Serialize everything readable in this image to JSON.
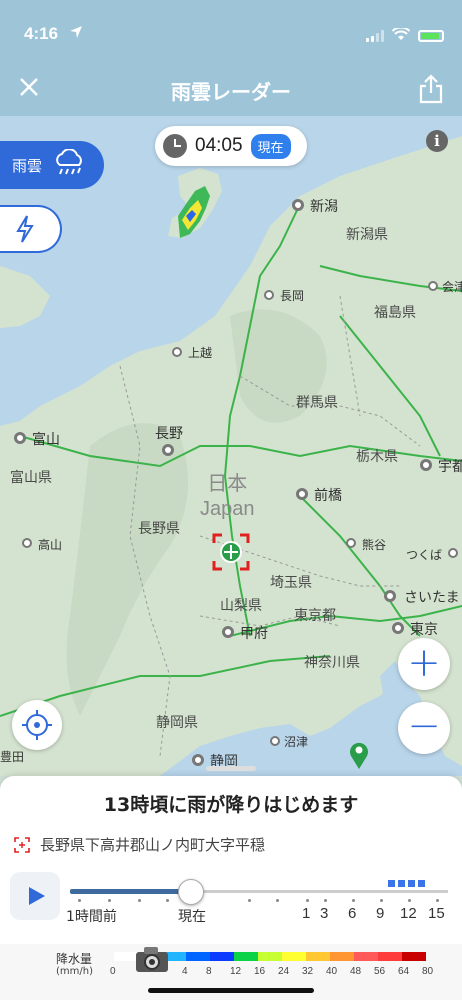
{
  "status_bar": {
    "time": "4:16"
  },
  "header": {
    "title": "雨雲レーダー"
  },
  "time_pill": {
    "time": "04:05",
    "badge": "現在"
  },
  "side_buttons": {
    "rain_label": "雨雲"
  },
  "map": {
    "cities": [
      {
        "name": "新潟"
      },
      {
        "name": "会津"
      },
      {
        "name": "長岡"
      },
      {
        "name": "上越"
      },
      {
        "name": "富山"
      },
      {
        "name": "長野"
      },
      {
        "name": "前橋"
      },
      {
        "name": "宇都"
      },
      {
        "name": "高山"
      },
      {
        "name": "熊谷"
      },
      {
        "name": "つくば"
      },
      {
        "name": "さいたま"
      },
      {
        "name": "甲府"
      },
      {
        "name": "東京"
      },
      {
        "name": "沼津"
      },
      {
        "name": "静岡"
      },
      {
        "name": "豊田"
      }
    ],
    "prefectures": [
      "新潟県",
      "福島県",
      "群馬県",
      "栃木県",
      "富山県",
      "長野県",
      "埼玉県",
      "山梨県",
      "東京都",
      "神奈川県",
      "静岡県"
    ],
    "country": "日本",
    "country_en": "Japan"
  },
  "sheet": {
    "forecast": "13時頃に雨が降りはじめます",
    "location": "長野県下高井郡山ノ内町大字平穏",
    "timeline": {
      "before": "1時間前",
      "now": "現在",
      "hours": [
        "1",
        "3",
        "6",
        "9",
        "12",
        "15"
      ],
      "progress_fraction": 0.32
    }
  },
  "legend": {
    "title": "降水量",
    "unit": "(mm/h)",
    "values": [
      "0",
      "",
      "",
      "4",
      "8",
      "12",
      "16",
      "24",
      "32",
      "40",
      "48",
      "56",
      "64",
      "80"
    ],
    "colors": [
      "#ffffff",
      "#a0d2ff",
      "#21b4ff",
      "#0064ff",
      "#0c3cff",
      "#0bd246",
      "#c8ff32",
      "#ffff32",
      "#ffc832",
      "#ff9632",
      "#ff5a5a",
      "#ff3c3c",
      "#c80000"
    ]
  },
  "colors": {
    "accent": "#2f6ad8",
    "header": "#9ec4d8"
  }
}
